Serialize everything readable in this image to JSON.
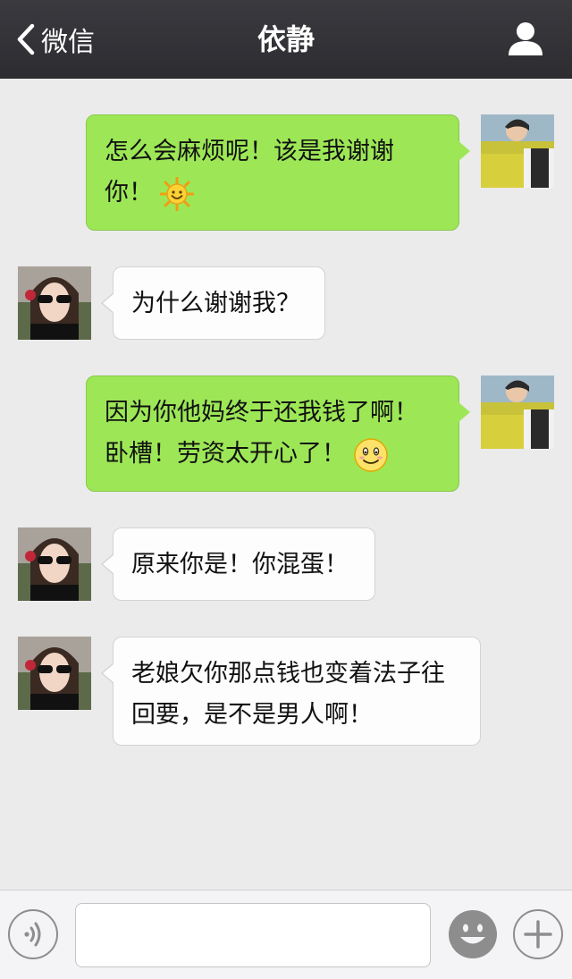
{
  "header": {
    "back_label": "微信",
    "title": "依静",
    "profile_icon": "person-icon"
  },
  "messages": [
    {
      "sender": "me",
      "lines": [
        "怎么会麻烦呢！该是我谢谢",
        "你！"
      ],
      "emoji": "sun-smile-emoji"
    },
    {
      "sender": "her",
      "lines": [
        "为什么谢谢我？"
      ]
    },
    {
      "sender": "me",
      "lines": [
        "因为你他妈终于还我钱了啊！",
        "卧槽！劳资太开心了！"
      ],
      "emoji": "smile-emoji"
    },
    {
      "sender": "her",
      "lines": [
        "原来你是！你混蛋！"
      ]
    },
    {
      "sender": "her",
      "lines": [
        "老娘欠你那点钱也变着法子往",
        "回要，是不是男人啊！"
      ]
    }
  ],
  "input": {
    "value": "",
    "placeholder": ""
  },
  "colors": {
    "header_bg": "#2f2f34",
    "chat_bg": "#ebebeb",
    "my_bubble": "#9de757",
    "her_bubble": "#fdfdfd"
  }
}
